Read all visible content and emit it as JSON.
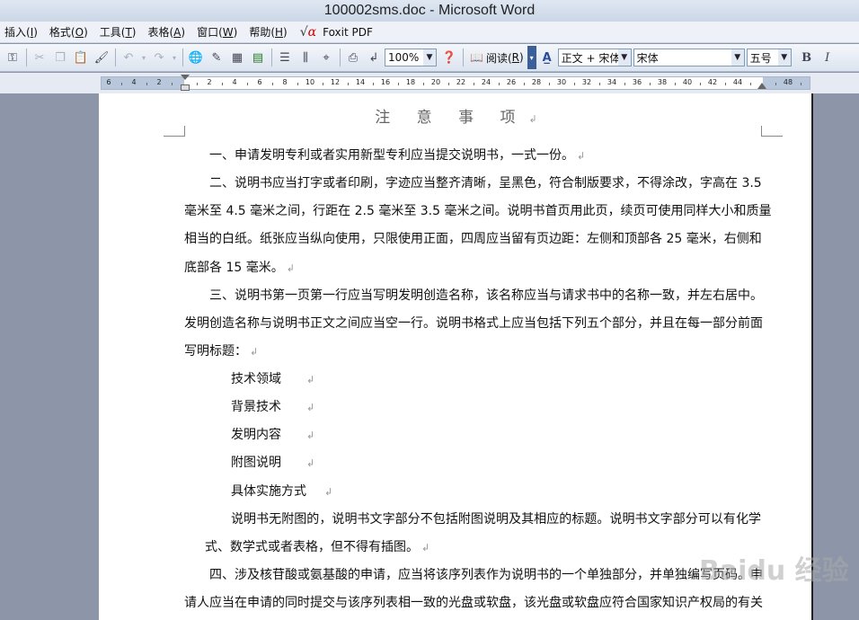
{
  "window": {
    "title": "100002sms.doc - Microsoft Word"
  },
  "menu": [
    {
      "label": "插入(",
      "key": "I",
      "tail": ")"
    },
    {
      "label": "格式(",
      "key": "O",
      "tail": ")"
    },
    {
      "label": "工具(",
      "key": "T",
      "tail": ")"
    },
    {
      "label": "表格(",
      "key": "A",
      "tail": ")"
    },
    {
      "label": "窗口(",
      "key": "W",
      "tail": ")"
    },
    {
      "label": "帮助(",
      "key": "H",
      "tail": ")"
    }
  ],
  "menu_extra": {
    "foxit": "Foxit PDF"
  },
  "toolbar": {
    "zoom": "100%",
    "read_label": "阅读(",
    "read_key": "R",
    "read_tail": ")",
    "style": "正文 + 宋体",
    "font": "宋体",
    "size": "五号",
    "bold": "B",
    "italic": "I"
  },
  "ruler": {
    "left_labels": [
      "6",
      "4",
      "2"
    ],
    "right_labels": [
      "2",
      "4",
      "6",
      "8",
      "10",
      "12",
      "14",
      "16",
      "18",
      "20",
      "22",
      "24",
      "26",
      "28",
      "30",
      "32",
      "34",
      "36",
      "38",
      "40",
      "42",
      "44",
      "48"
    ]
  },
  "document": {
    "title": "注 意 事 项",
    "lines": [
      "一、申请发明专利或者实用新型专利应当提交说明书，一式一份。",
      "二、说明书应当打字或者印刷，字迹应当整齐清晰，呈黑色，符合制版要求，不得涂改，字高在 3.5",
      "毫米至 4.5 毫米之间，行距在 2.5 毫米至 3.5 毫米之间。说明书首页用此页，续页可使用同样大小和质量",
      "相当的白纸。纸张应当纵向使用，只限使用正面，四周应当留有页边距：左侧和顶部各 25 毫米，右侧和",
      "底部各 15 毫米。",
      "三、说明书第一页第一行应当写明发明创造名称，该名称应当与请求书中的名称一致，并左右居中。",
      "发明创造名称与说明书正文之间应当空一行。说明书格式上应当包括下列五个部分，并且在每一部分前面",
      "写明标题：",
      "技术领域",
      "背景技术",
      "发明内容",
      "附图说明",
      "具体实施方式",
      "说明书无附图的，说明书文字部分不包括附图说明及其相应的标题。说明书文字部分可以有化学",
      "式、数学式或者表格，但不得有插图。",
      "四、涉及核苷酸或氨基酸的申请，应当将该序列表作为说明书的一个单独部分，并单独编写页码。申",
      "请人应当在申请的同时提交与该序列表相一致的光盘或软盘，该光盘或软盘应符合国家知识产权局的有关"
    ]
  },
  "watermark": "Baidu 经验"
}
